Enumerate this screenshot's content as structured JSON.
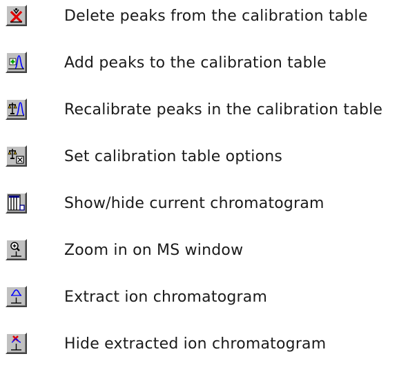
{
  "items": [
    {
      "icon": "delete-peaks-icon",
      "label": "Delete peaks from the calibration table"
    },
    {
      "icon": "add-peaks-icon",
      "label": "Add peaks to the calibration table"
    },
    {
      "icon": "recalibrate-peaks-icon",
      "label": "Recalibrate peaks in the calibration table"
    },
    {
      "icon": "calibration-options-icon",
      "label": "Set calibration table options"
    },
    {
      "icon": "chromatogram-toggle-icon",
      "label": "Show/hide current chromatogram"
    },
    {
      "icon": "zoom-in-icon",
      "label": "Zoom in on MS window"
    },
    {
      "icon": "extract-ion-icon",
      "label": "Extract ion chromatogram"
    },
    {
      "icon": "hide-extracted-ion-icon",
      "label": "Hide extracted ion chromatogram"
    }
  ]
}
